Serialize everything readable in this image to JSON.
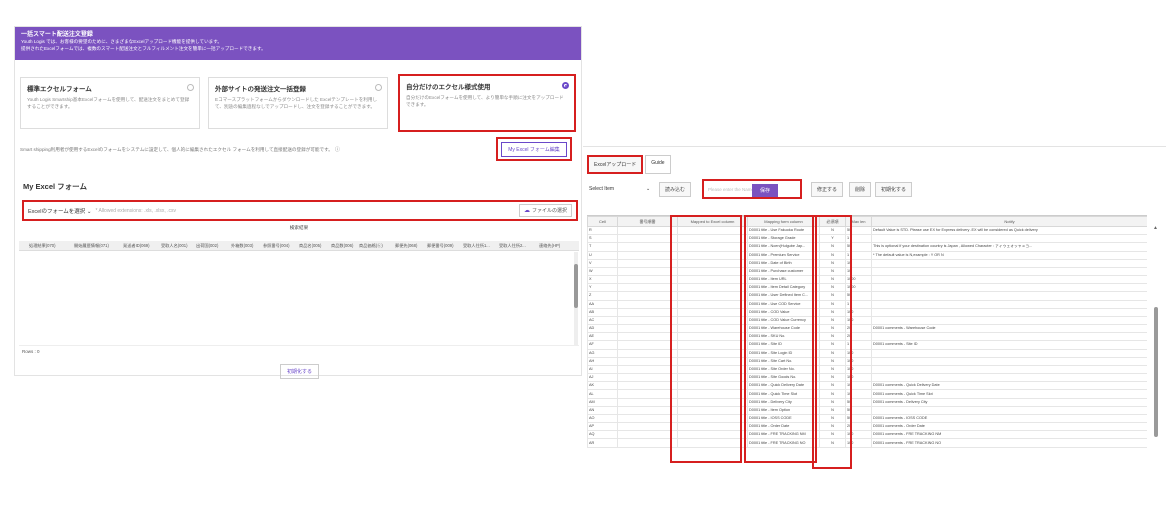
{
  "left": {
    "banner": {
      "title": "一括スマート配送注文登録",
      "line1": "Youth Logis では、お客様の要望のために、さまざまなExcelアップロード機能を提供しています。",
      "line2": "提供されたExcelフォームでは、複数のスマート配送注文とフルフィルメント注文を簡単に一括アップロードできます。"
    },
    "cards": [
      {
        "title": "標準エクセルフォーム",
        "desc": "Youth Logis Smartship基本Excelフォームを使用して、配送注文をまとめて登録することができます。",
        "selected": false
      },
      {
        "title": "外部サイトの発送注文一括登録",
        "desc": "Eコマースプラットフォームからダウンロードした Excelテンプレートを利用して、別途の編集過程なしでアップロードし、注文を登録することができます。",
        "selected": false
      },
      {
        "title": "自分だけのエクセル様式使用",
        "desc": "自分だけのExcelフォームを使用して、より簡単な手順に注文をアップロードできます。",
        "selected": true
      }
    ],
    "note": "Smart shipping利用者が使用するExcelのフォームをシステムに設定して、個人的に編集されたエクセル フォームを利用して直接配送の登録が可能です。",
    "edit_button": "My Excel フォーム編集",
    "section_title": "My Excel フォーム",
    "select_label": "Excelのフォームを選択",
    "placeholder": "* Allowed extensions: .xls, .xlsx, .csv",
    "file_button": "ファイルの選択",
    "grid_title": "検索結果",
    "grid_headers": [
      "処理結果(070)",
      "開始履歴情報(071)",
      "発送者ID(069)",
      "受取人名(001)",
      "出荷国(002)",
      "外箱数(003)",
      "参照番号(004)",
      "商品名(005)",
      "商品数(006)",
      "商品価格(ⓚ)",
      "郵便先(068)",
      "郵便番号(009)",
      "受取人住所1...",
      "受取人住所2...",
      "連絡先(HP)"
    ],
    "rows_label": "Rows : 0",
    "init_button": "初期化する"
  },
  "right": {
    "tabs": [
      "Excelアップロード",
      "Guide"
    ],
    "toolbar": {
      "select_label": "Select Item",
      "load_button": "読み込む",
      "search_placeholder": "Please enter the Name",
      "save_button": "保存",
      "edit_button": "修正する",
      "delete_button": "削除",
      "reset_button": "初期化する"
    },
    "headers": [
      "Cell",
      "番号順番",
      "Mapped to Excel column",
      "Mapping form column",
      "必須項",
      "Max len",
      "Notify"
    ],
    "rows": [
      [
        "R",
        "",
        "",
        "D0001 title - Use Fakuoka Route",
        "N",
        "50",
        "Default Value is STD. Please use EX for Express delivery .EX will be considered as Quick delivery"
      ],
      [
        "S",
        "",
        "",
        "D0001 title - Storage Grade",
        "Y",
        "1",
        ""
      ],
      [
        "T",
        "",
        "",
        "D0001 title - Noen(Hulgube Jap...",
        "N",
        "50",
        "This is optional if your destination country is Japan , Allowed Character : ァィゥェォッャュョ..."
      ],
      [
        "U",
        "",
        "",
        "D0001 title - Premium Service",
        "N",
        "1",
        "* The default value is N,example : Y OR N"
      ],
      [
        "V",
        "",
        "",
        "D0001 title - Date of Birth",
        "N",
        "10",
        ""
      ],
      [
        "W",
        "",
        "",
        "D0001 title - Purchase customer",
        "N",
        "10",
        ""
      ],
      [
        "X",
        "",
        "",
        "D0001 title - Item URL",
        "N",
        "1000",
        ""
      ],
      [
        "Y",
        "",
        "",
        "D0001 title - Item Detail Category",
        "N",
        "1000",
        ""
      ],
      [
        "Z",
        "",
        "",
        "D0001 title - User Defined Item C...",
        "N",
        "50",
        ""
      ],
      [
        "AA",
        "",
        "",
        "D0001 title - Use COD Service",
        "N",
        "1",
        ""
      ],
      [
        "AB",
        "",
        "",
        "D0001 title - COD Value",
        "N",
        "100",
        ""
      ],
      [
        "AC",
        "",
        "",
        "D0001 title - COD Value Currency",
        "N",
        "100",
        ""
      ],
      [
        "AD",
        "",
        "",
        "D0001 title - Warehouse Code",
        "N",
        "20",
        "D0001 comments - Warehouse Code"
      ],
      [
        "AE",
        "",
        "",
        "D0001 title - SKU No.",
        "N",
        "20",
        ""
      ],
      [
        "AF",
        "",
        "",
        "D0001 title - Site ID",
        "N",
        "1",
        "D0001 comments - Site ID"
      ],
      [
        "AG",
        "",
        "",
        "D0001 title - Site Login ID",
        "N",
        "100",
        ""
      ],
      [
        "AH",
        "",
        "",
        "D0001 title - Site Cart No.",
        "N",
        "100",
        ""
      ],
      [
        "AI",
        "",
        "",
        "D0001 title - Site Order No.",
        "N",
        "100",
        ""
      ],
      [
        "AJ",
        "",
        "",
        "D0001 title - Site Goods No.",
        "N",
        "100",
        ""
      ],
      [
        "AK",
        "",
        "",
        "D0001 title - Quick Delivery Date",
        "N",
        "10",
        "D0001 comments - Quick Delivery Date"
      ],
      [
        "AL",
        "",
        "",
        "D0001 title - Quick Time Slot",
        "N",
        "10",
        "D0001 comments - Quick Time Slot"
      ],
      [
        "AM",
        "",
        "",
        "D0001 title - Delivery City",
        "N",
        "50",
        "D0001 comments - Delivery City"
      ],
      [
        "AN",
        "",
        "",
        "D0001 title - Item Option",
        "N",
        "50",
        ""
      ],
      [
        "AO",
        "",
        "",
        "D0001 title - IOSS CODE",
        "N",
        "50",
        "D0001 comments - IOSS CODE"
      ],
      [
        "AP",
        "",
        "",
        "D0001 title - Order Date",
        "N",
        "20",
        "D0001 comments - Order Date"
      ],
      [
        "AQ",
        "",
        "",
        "D0001 title - FRE TRACKING NM",
        "N",
        "100",
        "D0001 comments - FRE TRACKING NM"
      ],
      [
        "AR",
        "",
        "",
        "D0001 title - FRE TRACKING NO",
        "N",
        "100",
        "D0001 comments - FRE TRACKING NO"
      ]
    ]
  },
  "colors": {
    "accent": "#7b52c0",
    "highlight": "#d61f1f"
  }
}
